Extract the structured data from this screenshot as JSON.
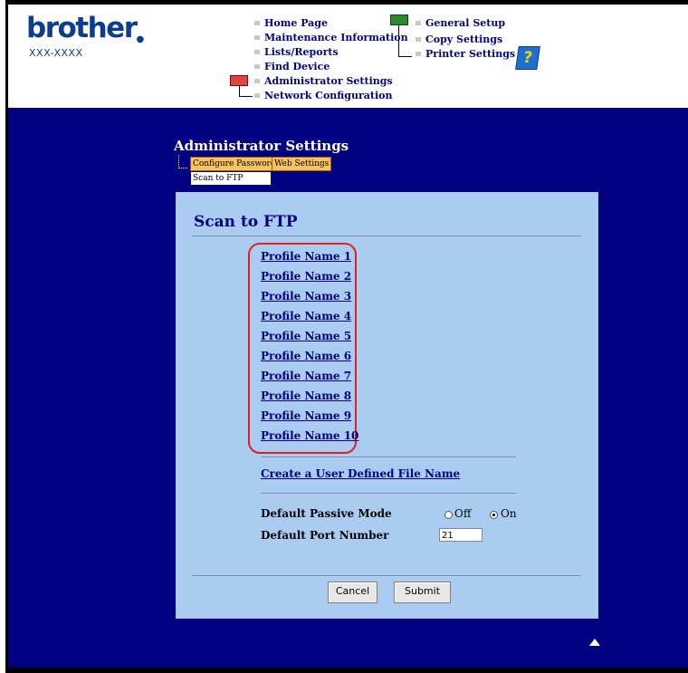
{
  "header": {
    "brand": "brother",
    "model": "XXX-XXXX",
    "nav_left": [
      {
        "label": "Home Page"
      },
      {
        "label": "Maintenance Information"
      },
      {
        "label": "Lists/Reports"
      },
      {
        "label": "Find Device"
      },
      {
        "label": "Administrator Settings"
      },
      {
        "label": "Network Configuration"
      }
    ],
    "nav_right": [
      {
        "label": "General Setup"
      },
      {
        "label": "Copy Settings"
      },
      {
        "label": "Printer Settings"
      }
    ],
    "help_glyph": "?"
  },
  "admin": {
    "title": "Administrator Settings",
    "tabs": [
      "Configure Password",
      "Web Settings",
      "Scan to FTP"
    ]
  },
  "panel": {
    "title": "Scan to FTP",
    "profiles": [
      "Profile Name 1",
      "Profile Name 2",
      "Profile Name 3",
      "Profile Name 4",
      "Profile Name 5",
      "Profile Name 6",
      "Profile Name 7",
      "Profile Name 8",
      "Profile Name 9",
      "Profile Name 10"
    ],
    "create_link": "Create a User Defined File Name",
    "passive_label": "Default Passive Mode",
    "passive_off": "Off",
    "passive_on": "On",
    "passive_selected": "On",
    "port_label": "Default Port Number",
    "port_value": "21",
    "cancel": "Cancel",
    "submit": "Submit"
  },
  "colors": {
    "page_bg": "#000080",
    "panel_bg": "#aaccf0",
    "highlight": "#e02020",
    "tab": "#f7c35c"
  }
}
